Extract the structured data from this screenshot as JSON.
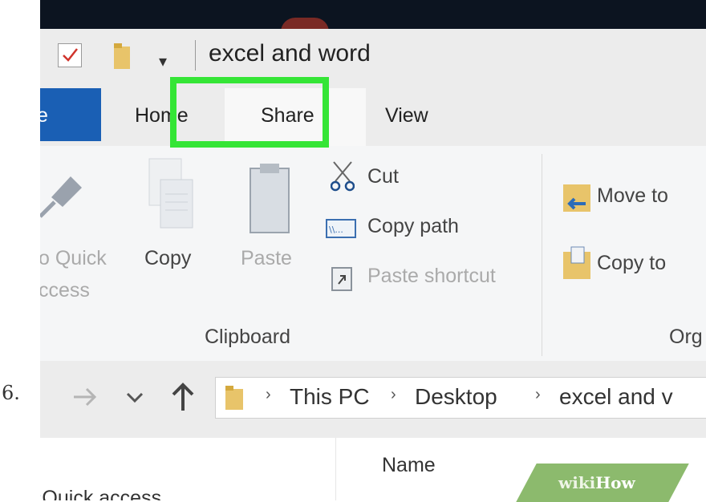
{
  "step_number": "6.",
  "window": {
    "title": "excel and word"
  },
  "quick_access": {
    "dropdown_glyph": "▾"
  },
  "tabs": [
    {
      "label": "e"
    },
    {
      "label": "Home"
    },
    {
      "label": "Share"
    },
    {
      "label": "View"
    }
  ],
  "highlighted_tab": "Share",
  "ribbon": {
    "pin": {
      "line1": "o Quick",
      "line2": "ccess"
    },
    "copy": "Copy",
    "paste": "Paste",
    "cut": "Cut",
    "copy_path": "Copy path",
    "paste_shortcut": "Paste shortcut",
    "group_clipboard": "Clipboard",
    "move_to": "Move to",
    "copy_to": "Copy to",
    "group_organize": "Org"
  },
  "address_bar": {
    "segments": [
      "This PC",
      "Desktop",
      "excel and v"
    ],
    "separator": "›"
  },
  "file_list": {
    "column_name": "Name"
  },
  "nav_pane": {
    "quick_access": "Quick access"
  },
  "watermark": {
    "wiki": "wiki",
    "how": "How"
  },
  "colors": {
    "highlight": "#35e536",
    "file_tab": "#1a5fb4",
    "watermark": "#8cba6d"
  }
}
